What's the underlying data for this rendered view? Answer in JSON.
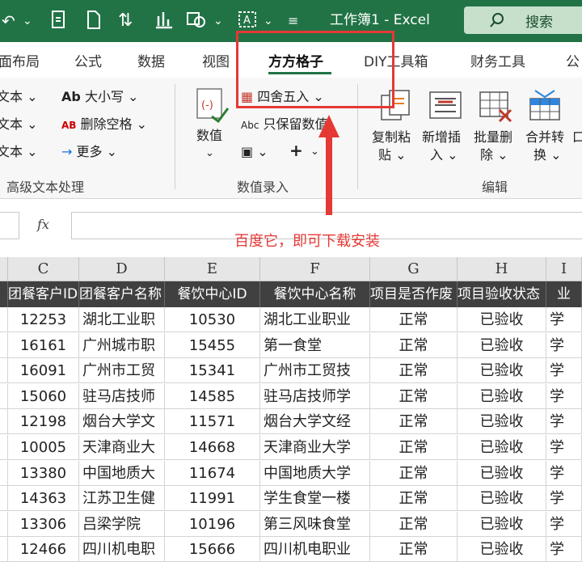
{
  "titlebar": {
    "title": "工作簿1  -  Excel",
    "search_label": "搜索"
  },
  "tabs": [
    {
      "label": "面布局"
    },
    {
      "label": "公式"
    },
    {
      "label": "数据"
    },
    {
      "label": "视图"
    },
    {
      "label": "方方格子"
    },
    {
      "label": "DIY工具箱"
    },
    {
      "label": "财务工具"
    },
    {
      "label": "公"
    }
  ],
  "ribbon": {
    "left_items": [
      "文本",
      "文本",
      "文本"
    ],
    "case_label": "大小写",
    "trim_label": "删除空格",
    "more_label": "更多",
    "group_text": "高级文本处理",
    "numeric_label": "数值",
    "round_label": "四舍五入",
    "keep_number_label": "只保留数值",
    "abc_prefix": "Abc",
    "ab_prefix": "Ab",
    "ab_small": "AB",
    "group_numeric": "数值录入",
    "copy_paste_label": [
      "复制粘",
      "贴"
    ],
    "insert_label": [
      "新增插",
      "入"
    ],
    "batch_delete_label": [
      "批量删",
      "除"
    ],
    "merge_label": [
      "合并转",
      "换"
    ],
    "edit_more_label": "口",
    "group_edit": "编辑"
  },
  "annotation": "百度它，即可下载安装",
  "formula_bar": {
    "fx": "fx",
    "value": ""
  },
  "columns": [
    "C",
    "D",
    "E",
    "F",
    "G",
    "H",
    "I"
  ],
  "header_row": [
    "团餐客户ID",
    "团餐客户名称",
    "餐饮中心ID",
    "餐饮中心名称",
    "项目是否作废",
    "项目验收状态",
    "业"
  ],
  "rows": [
    {
      "b": "",
      "c": "12253",
      "d": "湖北工业职",
      "e": "10530",
      "f": "湖北工业职业",
      "g": "正常",
      "h": "已验收",
      "i": "学"
    },
    {
      "b": "",
      "c": "16161",
      "d": "广州城市职",
      "e": "15455",
      "f": "第一食堂",
      "g": "正常",
      "h": "已验收",
      "i": "学"
    },
    {
      "b": "",
      "c": "16091",
      "d": "广州市工贸",
      "e": "15341",
      "f": "广州市工贸技",
      "g": "正常",
      "h": "已验收",
      "i": "学"
    },
    {
      "b": "",
      "c": "15060",
      "d": "驻马店技师",
      "e": "14585",
      "f": "驻马店技师学",
      "g": "正常",
      "h": "已验收",
      "i": "学"
    },
    {
      "b": "",
      "c": "12198",
      "d": "烟台大学文",
      "e": "11571",
      "f": "烟台大学文经",
      "g": "正常",
      "h": "已验收",
      "i": "学"
    },
    {
      "b": "",
      "c": "10005",
      "d": "天津商业大",
      "e": "14668",
      "f": "天津商业大学",
      "g": "正常",
      "h": "已验收",
      "i": "学"
    },
    {
      "b": "",
      "c": "13380",
      "d": "中国地质大",
      "e": "11674",
      "f": "中国地质大学",
      "g": "正常",
      "h": "已验收",
      "i": "学"
    },
    {
      "b": "",
      "c": "14363",
      "d": "江苏卫生健",
      "e": "11991",
      "f": "学生食堂一楼",
      "g": "正常",
      "h": "已验收",
      "i": "学"
    },
    {
      "b": "",
      "c": "13306",
      "d": "吕梁学院",
      "e": "10196",
      "f": "第三风味食堂",
      "g": "正常",
      "h": "已验收",
      "i": "学"
    },
    {
      "b": "",
      "c": "12466",
      "d": "四川机电职",
      "e": "15666",
      "f": "四川机电职业",
      "g": "正常",
      "h": "已验收",
      "i": "学"
    }
  ],
  "colors": {
    "excel_green": "#217346",
    "annotation_red": "#e53935",
    "header_dark": "#404040"
  }
}
